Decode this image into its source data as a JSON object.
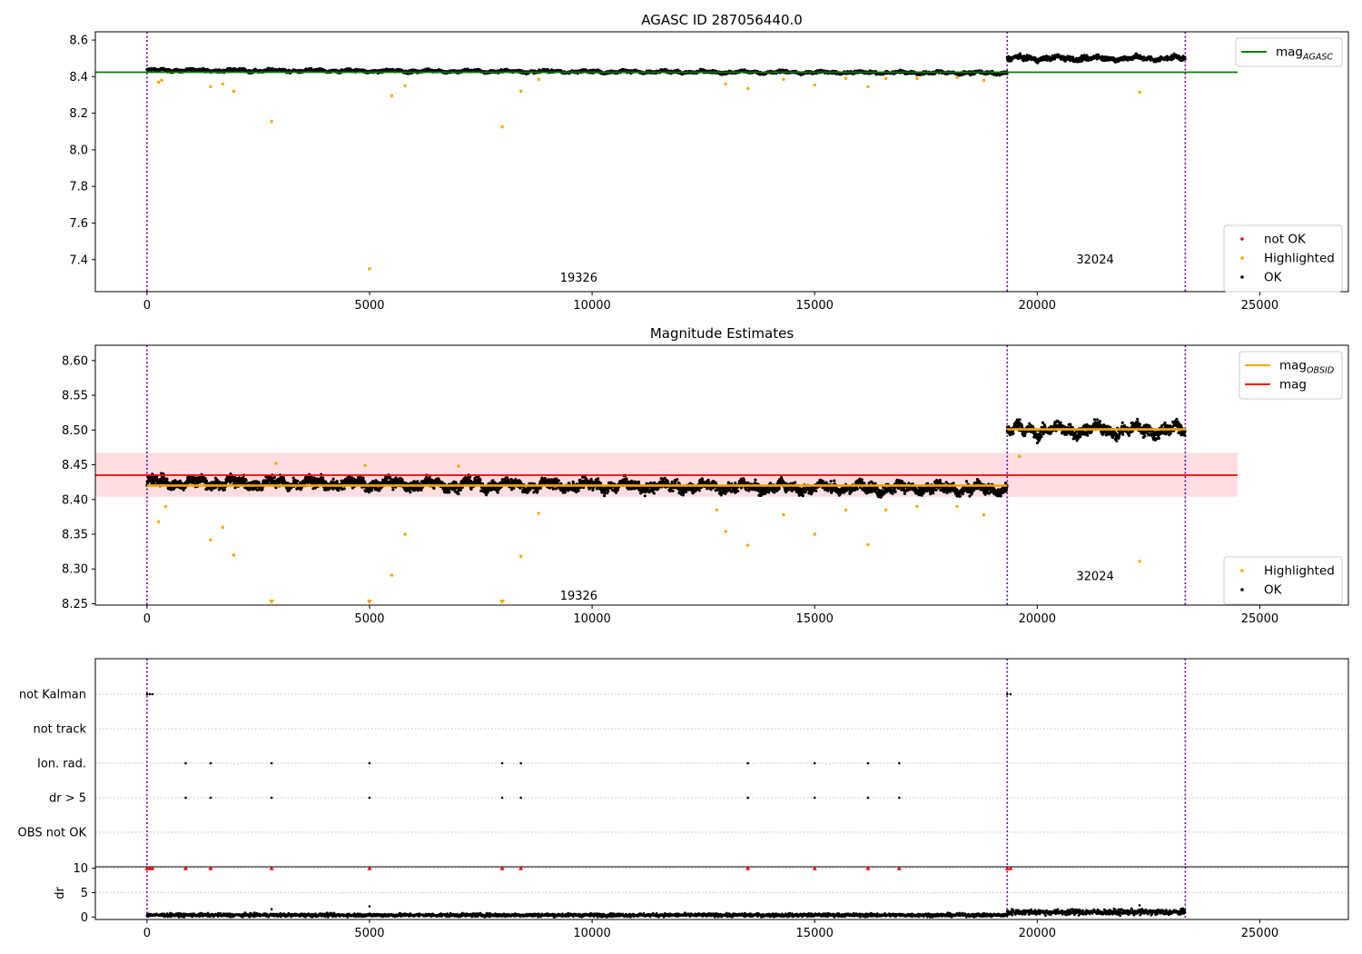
{
  "chart_data": [
    {
      "type": "scatter",
      "title": "AGASC ID 287056440.0",
      "xlabel": "",
      "ylabel": "",
      "xlim": [
        -1160,
        26990
      ],
      "ylim": [
        7.225,
        8.645
      ],
      "x_ticks": [
        0,
        5000,
        10000,
        15000,
        20000,
        25000
      ],
      "y_ticks": [
        7.4,
        7.6,
        7.8,
        8.0,
        8.2,
        8.4,
        8.6
      ],
      "obsid_boundaries": [
        0,
        19326,
        23326
      ],
      "obsid_labels": [
        {
          "x": 9700,
          "y": 7.3,
          "text": "19326"
        },
        {
          "x": 21300,
          "y": 7.4,
          "text": "32024"
        }
      ],
      "mag_agasc": 8.424,
      "mag_agasc_xrange": [
        -1160,
        24500
      ],
      "ok_bands": [
        {
          "x0": 0,
          "x1": 19326,
          "y0": 8.435,
          "y1": 8.42,
          "spread": 0.012
        },
        {
          "x0": 19326,
          "x1": 23326,
          "y0": 8.5,
          "y1": 8.5,
          "spread": 0.02
        }
      ],
      "highlighted": [
        [
          260,
          8.37
        ],
        [
          330,
          8.38
        ],
        [
          1430,
          8.345
        ],
        [
          1700,
          8.36
        ],
        [
          1950,
          8.32
        ],
        [
          2800,
          8.155
        ],
        [
          5000,
          7.35
        ],
        [
          5500,
          8.295
        ],
        [
          5800,
          8.35
        ],
        [
          7980,
          8.125
        ],
        [
          8400,
          8.32
        ],
        [
          8800,
          8.385
        ],
        [
          13000,
          8.36
        ],
        [
          13500,
          8.335
        ],
        [
          14300,
          8.385
        ],
        [
          15000,
          8.355
        ],
        [
          15700,
          8.39
        ],
        [
          16200,
          8.345
        ],
        [
          16600,
          8.39
        ],
        [
          17300,
          8.39
        ],
        [
          18200,
          8.395
        ],
        [
          18800,
          8.38
        ],
        [
          22300,
          8.315
        ]
      ],
      "legend": [
        "mag_AGASC",
        "not OK",
        "Highlighted",
        "OK"
      ]
    },
    {
      "type": "scatter",
      "title": "Magnitude Estimates",
      "xlabel": "",
      "ylabel": "",
      "xlim": [
        -1160,
        26990
      ],
      "ylim": [
        8.248,
        8.622
      ],
      "x_ticks": [
        0,
        5000,
        10000,
        15000,
        20000,
        25000
      ],
      "y_ticks": [
        8.25,
        8.3,
        8.35,
        8.4,
        8.45,
        8.5,
        8.55,
        8.6
      ],
      "obsid_boundaries": [
        0,
        19326,
        23326
      ],
      "obsid_labels": [
        {
          "x": 9700,
          "y": 8.261,
          "text": "19326"
        },
        {
          "x": 21300,
          "y": 8.289,
          "text": "32024"
        }
      ],
      "mag": 8.435,
      "mag_band": [
        8.404,
        8.467
      ],
      "mag_xrange": [
        -1160,
        24500
      ],
      "mag_obsid": [
        {
          "x0": 0,
          "x1": 19326,
          "value": 8.42
        },
        {
          "x0": 19326,
          "x1": 23326,
          "value": 8.501
        }
      ],
      "ok_bands": [
        {
          "x0": 0,
          "x1": 19326,
          "y0": 8.425,
          "y1": 8.415,
          "spread": 0.012
        },
        {
          "x0": 19326,
          "x1": 23326,
          "y0": 8.5,
          "y1": 8.5,
          "spread": 0.014
        }
      ],
      "highlighted": [
        [
          260,
          8.368
        ],
        [
          420,
          8.39
        ],
        [
          1430,
          8.342
        ],
        [
          1700,
          8.36
        ],
        [
          1950,
          8.32
        ],
        [
          5500,
          8.291
        ],
        [
          5800,
          8.35
        ],
        [
          8400,
          8.318
        ],
        [
          8800,
          8.38
        ],
        [
          12800,
          8.385
        ],
        [
          13000,
          8.354
        ],
        [
          13500,
          8.334
        ],
        [
          14300,
          8.378
        ],
        [
          15000,
          8.35
        ],
        [
          15700,
          8.385
        ],
        [
          16200,
          8.335
        ],
        [
          16600,
          8.385
        ],
        [
          17300,
          8.39
        ],
        [
          18200,
          8.39
        ],
        [
          18800,
          8.378
        ],
        [
          19600,
          8.462
        ],
        [
          22300,
          8.311
        ],
        [
          2900,
          8.452
        ],
        [
          4900,
          8.449
        ],
        [
          7000,
          8.448
        ]
      ],
      "clipped_low": [
        2800,
        5000,
        7980
      ],
      "legend": [
        "mag_OBSID",
        "mag",
        "Highlighted",
        "OK"
      ]
    },
    {
      "type": "scatter",
      "title": "",
      "xlabel": "",
      "ylabel": "",
      "xlim": [
        -1160,
        26990
      ],
      "flag_rows": [
        "not Kalman",
        "not track",
        "Ion. rad.",
        "dr > 5",
        "OBS not OK"
      ],
      "flag_points": {
        "not Kalman": [
          0,
          60,
          120,
          19326,
          19400
        ],
        "not track": [],
        "Ion. rad.": [
          870,
          1430,
          2800,
          5000,
          7980,
          8400,
          13500,
          15000,
          16200,
          16900
        ],
        "dr > 5": [
          870,
          1430,
          2800,
          5000,
          7980,
          8400,
          13500,
          15000,
          16200,
          16900
        ],
        "OBS not OK": []
      },
      "obsid_boundaries": [
        0,
        19326,
        23326
      ]
    },
    {
      "type": "scatter",
      "title": "",
      "xlabel": "",
      "ylabel": "dr",
      "xlim": [
        -1160,
        26990
      ],
      "ylim": [
        -0.5,
        10.3
      ],
      "x_ticks": [
        0,
        5000,
        10000,
        15000,
        20000,
        25000
      ],
      "y_ticks": [
        0,
        5,
        10
      ],
      "obsid_boundaries": [
        0,
        19326,
        23326
      ],
      "dr_bands": [
        {
          "x0": 0,
          "x1": 19326,
          "level": 0.4,
          "spread": 0.35
        },
        {
          "x0": 19326,
          "x1": 23326,
          "level": 1.0,
          "spread": 0.6
        }
      ],
      "dr_outliers": [
        [
          2800,
          1.6
        ],
        [
          5000,
          2.2
        ],
        [
          22300,
          2.4
        ]
      ],
      "dr_clipped": [
        0,
        60,
        120,
        870,
        1430,
        2800,
        5000,
        7980,
        8400,
        13500,
        15000,
        16200,
        16900,
        19326,
        19400
      ]
    }
  ],
  "legends": {
    "top": [
      {
        "kind": "line",
        "color": "#008000",
        "base": "mag",
        "sub": "AGASC"
      },
      {
        "kind": "dot",
        "color": "#ff0000",
        "label": "not OK"
      },
      {
        "kind": "dot",
        "color": "#ffa500",
        "label": "Highlighted"
      },
      {
        "kind": "dot",
        "color": "#000000",
        "label": "OK"
      }
    ],
    "mid": [
      {
        "kind": "line",
        "color": "#ffa500",
        "base": "mag",
        "sub": "OBSID"
      },
      {
        "kind": "line",
        "color": "#ff0000",
        "label": "mag"
      },
      {
        "kind": "dot",
        "color": "#ffa500",
        "label": "Highlighted"
      },
      {
        "kind": "dot",
        "color": "#000000",
        "label": "OK"
      }
    ]
  },
  "colors": {
    "ok": "#000000",
    "highlighted": "#ffa500",
    "not_ok": "#ff0000",
    "agasc_line": "#008000",
    "obsid_line": "#ffa500",
    "mag_line": "#ff0000",
    "mag_band": "#ffdde0",
    "obsid_boundary": "#7000b0"
  }
}
